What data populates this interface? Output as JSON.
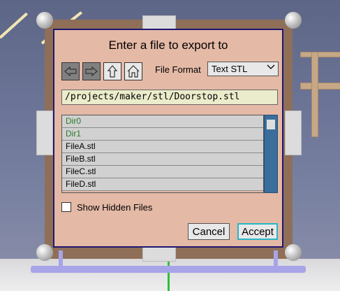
{
  "dialog": {
    "title": "Enter a file to export to",
    "nav": {
      "back_icon": "arrow-left-icon",
      "forward_icon": "arrow-right-icon",
      "up_icon": "arrow-up-icon",
      "home_icon": "home-icon"
    },
    "format_label": "File Format",
    "format_value": "Text STL",
    "path_value": "/projects/maker/stl/Doorstop.stl",
    "files": [
      {
        "name": "Dir0",
        "kind": "dir"
      },
      {
        "name": "Dir1",
        "kind": "dir"
      },
      {
        "name": "FileA.stl",
        "kind": "file"
      },
      {
        "name": "FileB.stl",
        "kind": "file"
      },
      {
        "name": "FileC.stl",
        "kind": "file"
      },
      {
        "name": "FileD.stl",
        "kind": "file"
      }
    ],
    "show_hidden_label": "Show Hidden Files",
    "show_hidden_checked": false,
    "cancel_label": "Cancel",
    "accept_label": "Accept"
  },
  "colors": {
    "dialog_bg": "#e4b9a6",
    "dialog_border": "#1e1673",
    "dir_text": "#2c7a2c",
    "scrollbar": "#3a6e9c",
    "accept_focus": "#29b6c8"
  }
}
